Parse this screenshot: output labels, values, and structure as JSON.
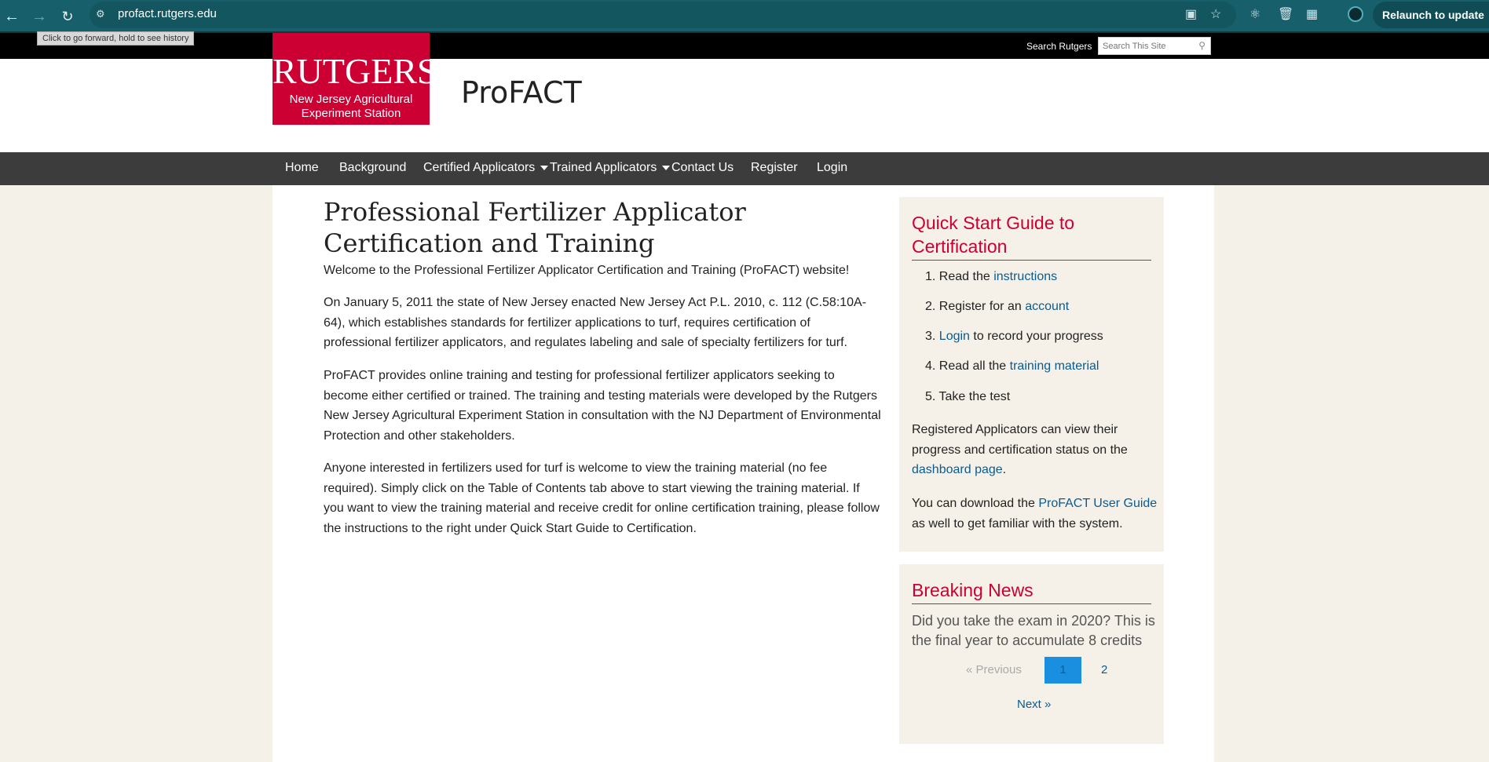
{
  "browser": {
    "url": "profact.rutgers.edu",
    "tooltip": "Click to go forward, hold to see history",
    "relaunch_label": "Relaunch to update"
  },
  "topbar": {
    "search_label": "Search Rutgers",
    "search_placeholder": "Search This Site"
  },
  "header": {
    "logo_word": "RUTGERS",
    "logo_sub1": "New Jersey Agricultural",
    "logo_sub2": "Experiment Station",
    "site_title": "ProFACT"
  },
  "nav": {
    "items": [
      "Home",
      "Background",
      "Certified Applicators",
      "Trained Applicators",
      "Contact Us",
      "Register",
      "Login"
    ]
  },
  "main": {
    "title": "Professional Fertilizer Applicator Certification and Training",
    "p1": "Welcome to the Professional Fertilizer Applicator Certification and Training (ProFACT) website!",
    "p2": "On January 5, 2011 the state of New Jersey enacted New Jersey Act P.L. 2010, c. 112 (C.58:10A-64), which establishes standards for fertilizer applications to turf, requires certification of professional fertilizer applicators, and regulates labeling and sale of specialty fertilizers for turf.",
    "p3": "ProFACT provides online training and testing for professional fertilizer applicators seeking to become either certified or trained. The training and testing materials were developed by the Rutgers New Jersey Agricultural Experiment Station in consultation with the NJ Department of Environmental Protection and other stakeholders.",
    "p4": "Anyone interested in fertilizers used for turf is welcome to view the training material (no fee required). Simply click on the Table of Contents tab above to start viewing the training material. If you want to view the training material and receive credit for online certification training, please follow the instructions to the right under Quick Start Guide to Certification."
  },
  "quickstart": {
    "heading1": "Quick Start Guide to",
    "heading2": "Certification",
    "steps": [
      {
        "num": "1.",
        "pre": "Read the ",
        "link": "instructions",
        "post": ""
      },
      {
        "num": "2.",
        "pre": "Register for an ",
        "link": "account",
        "post": ""
      },
      {
        "num": "3.",
        "pre": "",
        "link": "Login",
        "post": " to record your progress"
      },
      {
        "num": "4.",
        "pre": "Read all the ",
        "link": "training material",
        "post": ""
      },
      {
        "num": "5.",
        "pre": "Take the test",
        "link": "",
        "post": ""
      }
    ],
    "registered_text": "Registered Applicators can view their progress and certification status on the",
    "dashboard_link": "dashboard page",
    "period": ".",
    "download_text": "You can download the",
    "guide_link": "ProFACT User Guide",
    "download_post": "as well to get familiar with the system."
  },
  "news": {
    "heading": "Breaking News",
    "text": "Did you take the exam in 2020? This is the final year to accumulate 8 credits",
    "prev": "«  Previous",
    "page1": "1",
    "page2": "2",
    "next": "Next  »"
  }
}
